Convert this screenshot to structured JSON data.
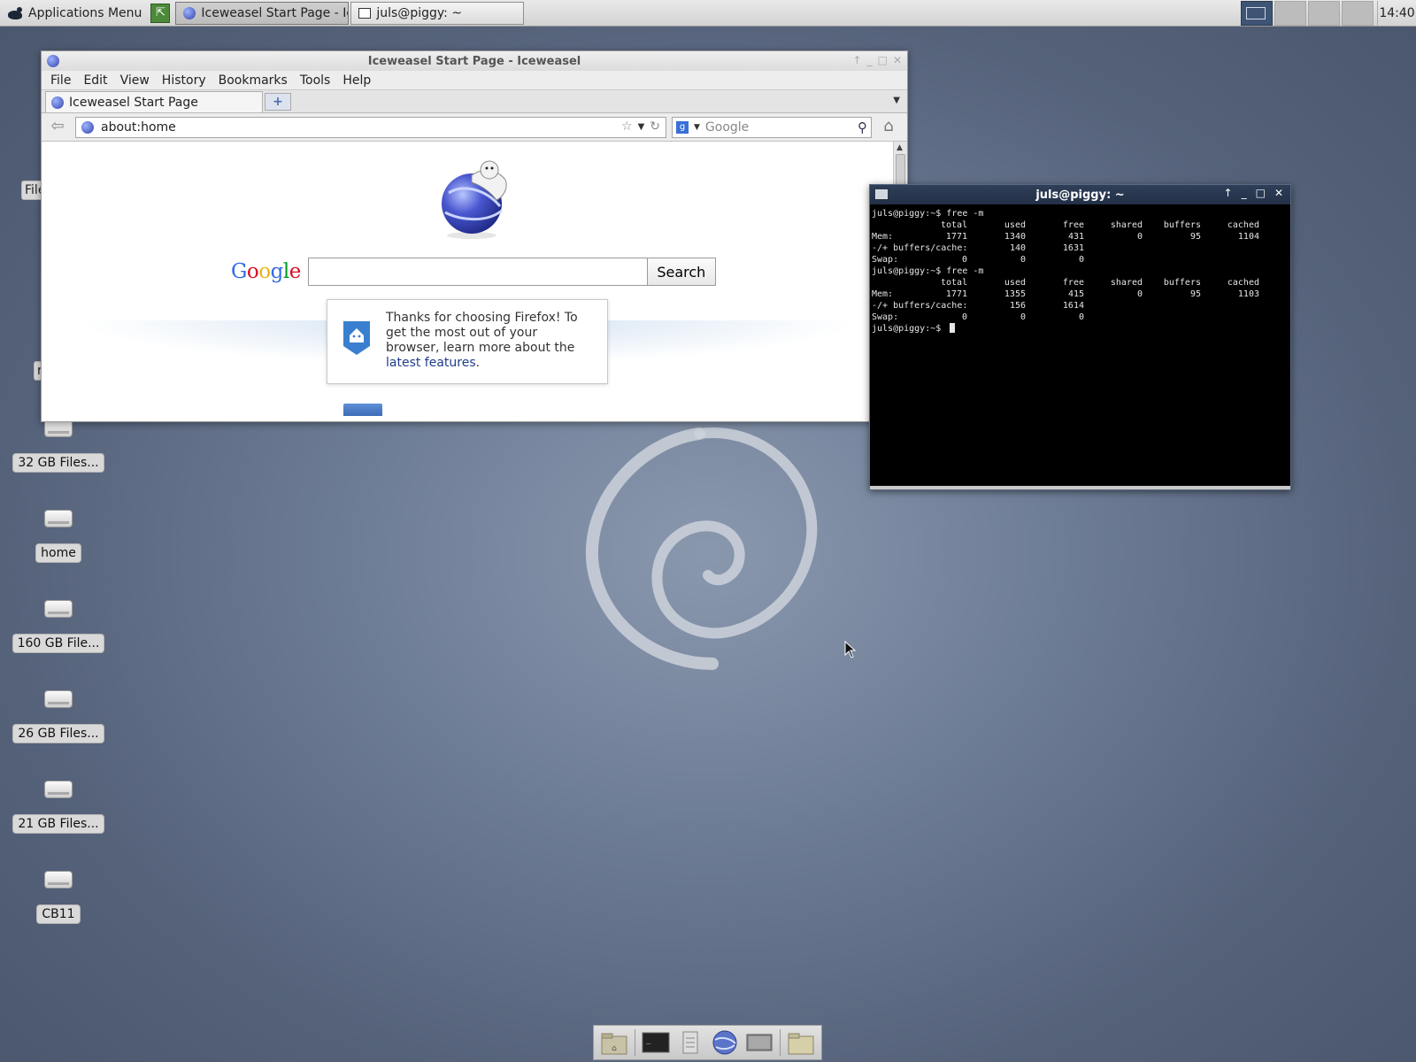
{
  "panel": {
    "apps_menu": "Applications Menu",
    "tasks": [
      {
        "label": "Iceweasel Start Page - Ic...",
        "active": true
      },
      {
        "label": "juls@piggy: ~",
        "active": false
      }
    ],
    "clock": "14:40"
  },
  "desktop": {
    "partial_labels": [
      "File",
      "r"
    ],
    "icons": [
      {
        "label": "32 GB Files..."
      },
      {
        "label": "home"
      },
      {
        "label": "160 GB File..."
      },
      {
        "label": "26 GB Files..."
      },
      {
        "label": "21 GB Files..."
      },
      {
        "label": "CB11"
      }
    ]
  },
  "browser": {
    "title": "Iceweasel Start Page - Iceweasel",
    "menu": [
      "File",
      "Edit",
      "View",
      "History",
      "Bookmarks",
      "Tools",
      "Help"
    ],
    "tab_label": "Iceweasel Start Page",
    "new_tab": "+",
    "url": "about:home",
    "search_placeholder": "Google",
    "google_search_button": "Search",
    "google_logo": "Google",
    "snippet": {
      "text": "Thanks for choosing Firefox! To get the most out of your browser, learn more about the ",
      "link": "latest features",
      "end": "."
    }
  },
  "terminal": {
    "title": "juls@piggy: ~",
    "prompt": "juls@piggy:~$ ",
    "command": "free -m",
    "header": [
      "",
      "total",
      "used",
      "free",
      "shared",
      "buffers",
      "cached"
    ],
    "blocks": [
      [
        [
          "Mem:",
          "1771",
          "1340",
          "431",
          "0",
          "95",
          "1104"
        ],
        [
          "-/+ buffers/cache:",
          "",
          "140",
          "1631",
          "",
          "",
          ""
        ],
        [
          "Swap:",
          "0",
          "0",
          "0",
          "",
          "",
          ""
        ]
      ],
      [
        [
          "Mem:",
          "1771",
          "1355",
          "415",
          "0",
          "95",
          "1103"
        ],
        [
          "-/+ buffers/cache:",
          "",
          "156",
          "1614",
          "",
          "",
          ""
        ],
        [
          "Swap:",
          "0",
          "0",
          "0",
          "",
          "",
          ""
        ]
      ]
    ]
  },
  "colors": {
    "desktop_bg": "#6e7d96",
    "terminal_bg": "#000000",
    "terminal_titlebar": "#2f3f58",
    "link": "#203c8c"
  }
}
